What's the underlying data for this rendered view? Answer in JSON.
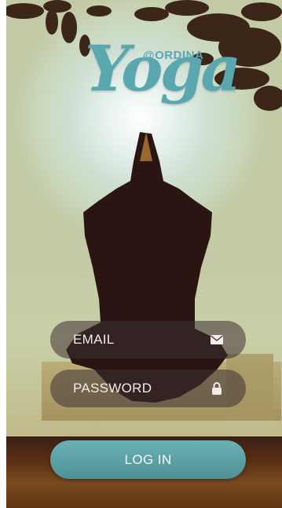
{
  "app": {
    "brand_prefix": "@ORDINA",
    "brand_name": "Yoga"
  },
  "form": {
    "email_placeholder": "EMAIL",
    "password_placeholder": "PASSWORD",
    "login_label": "LOG IN"
  },
  "icons": {
    "email": "envelope-icon",
    "password": "lock-icon"
  },
  "colors": {
    "accent": "#5aa7b0",
    "button": "#5a9fa4",
    "field_bg": "#3c3032"
  }
}
